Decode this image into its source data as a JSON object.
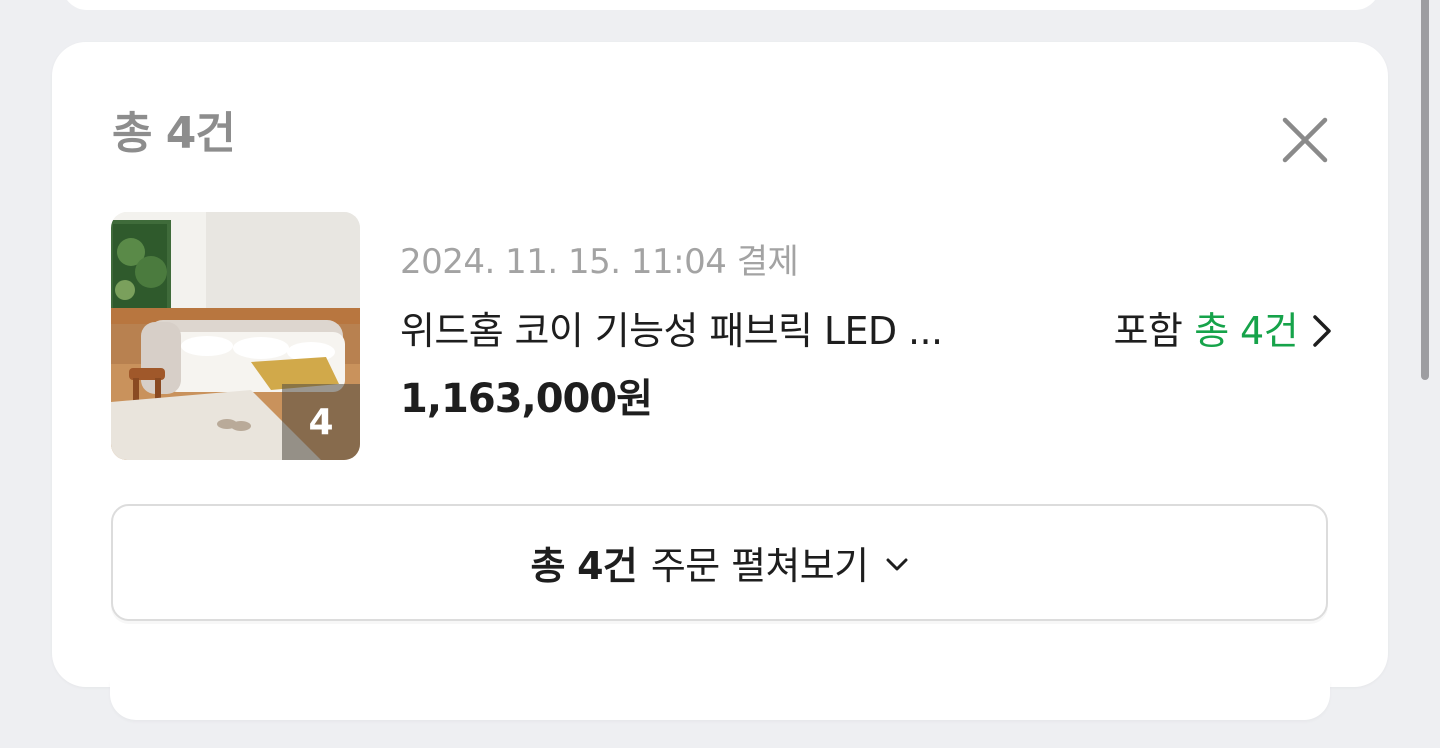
{
  "header": {
    "count_title": "총 4건"
  },
  "order": {
    "date": "2024. 11. 15. 11:04 결제",
    "product_name": "위드홈 코이 기능성 패브릭 LED ...",
    "include_label": "포함",
    "include_count": "총 4건",
    "price": "1,163,000원",
    "thumbnail_badge": "4"
  },
  "expand": {
    "strong": "총 4건",
    "text": "주문 펼쳐보기"
  },
  "icons": {
    "close": "close-icon",
    "chevron_right": "chevron-right-icon",
    "chevron_down": "chevron-down-icon"
  },
  "colors": {
    "background": "#eeeff2",
    "card": "#ffffff",
    "accent_green": "#16a34a",
    "muted_text": "#8d8d8d"
  }
}
